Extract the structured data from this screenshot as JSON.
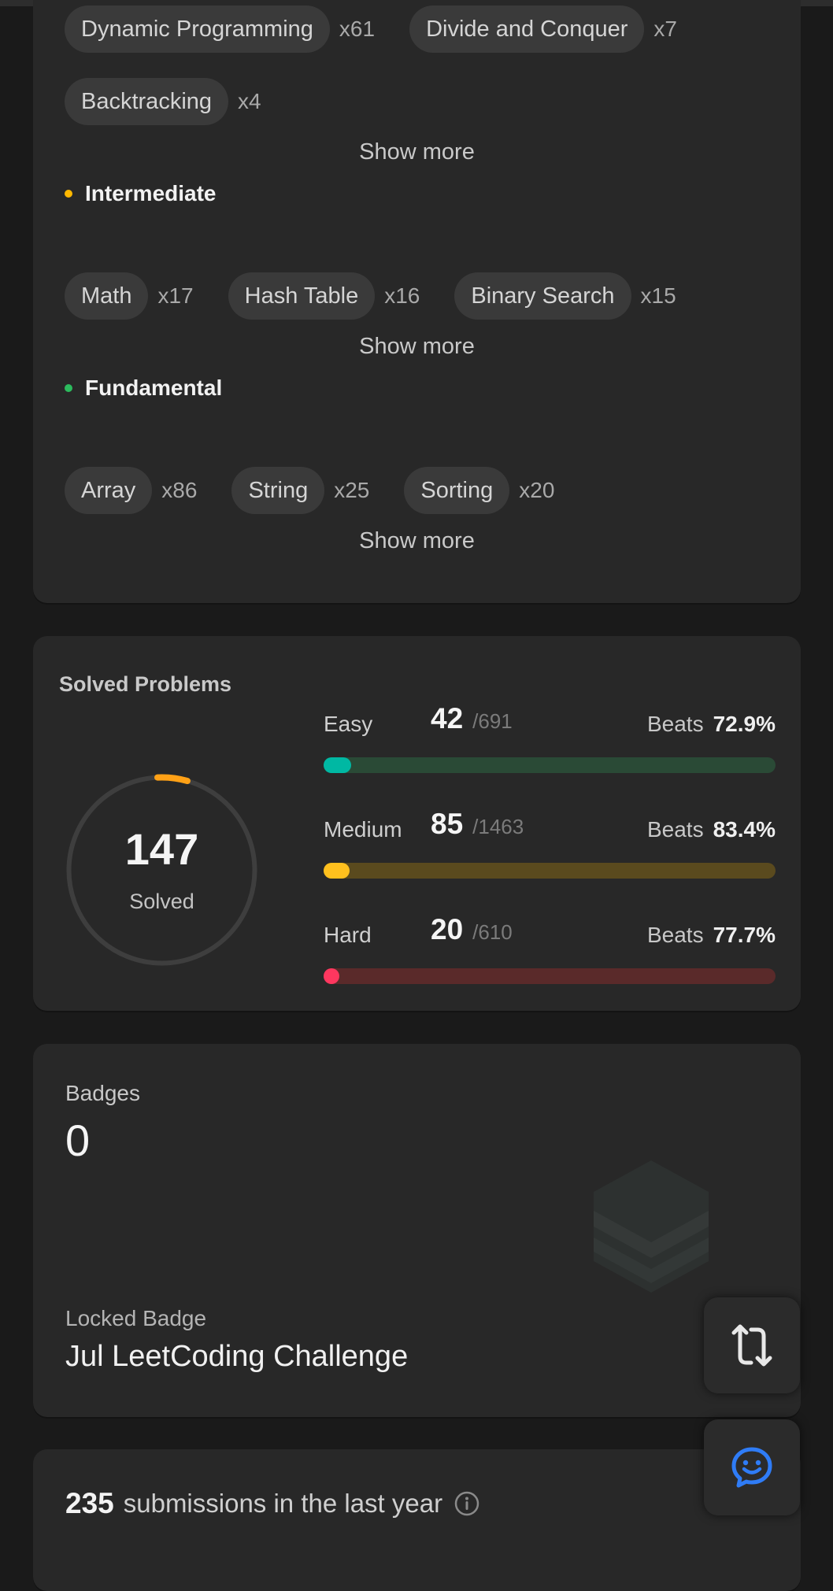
{
  "skills": {
    "advanced_tags": [
      {
        "name": "Dynamic Programming",
        "count": "x61"
      },
      {
        "name": "Divide and Conquer",
        "count": "x7"
      },
      {
        "name": "Backtracking",
        "count": "x4"
      }
    ],
    "intermediate": {
      "label": "Intermediate",
      "tags": [
        {
          "name": "Math",
          "count": "x17"
        },
        {
          "name": "Hash Table",
          "count": "x16"
        },
        {
          "name": "Binary Search",
          "count": "x15"
        }
      ]
    },
    "fundamental": {
      "label": "Fundamental",
      "tags": [
        {
          "name": "Array",
          "count": "x86"
        },
        {
          "name": "String",
          "count": "x25"
        },
        {
          "name": "Sorting",
          "count": "x20"
        }
      ]
    },
    "show_more_label": "Show more",
    "colors": {
      "intermediate_dot": "#ffb800",
      "fundamental_dot": "#2cbb5d"
    }
  },
  "solved": {
    "title": "Solved Problems",
    "total": "147",
    "total_label": "Solved",
    "beats_label": "Beats",
    "difficulties": [
      {
        "name": "Easy",
        "solved": "42",
        "total": "/691",
        "beats": "72.9%",
        "color": "#00b8a3",
        "track": "#2a4a36",
        "progress": 0.061
      },
      {
        "name": "Medium",
        "solved": "85",
        "total": "/1463",
        "beats": "83.4%",
        "color": "#ffc01e",
        "track": "#5a4a1e",
        "progress": 0.058
      },
      {
        "name": "Hard",
        "solved": "20",
        "total": "/610",
        "beats": "77.7%",
        "color": "#ff375f",
        "track": "#5a2a2a",
        "progress": 0.033
      }
    ],
    "ring": {
      "arc_color": "#ffa116",
      "track_color": "#3e3e3e"
    }
  },
  "badges": {
    "label": "Badges",
    "count": "0",
    "locked_label": "Locked Badge",
    "locked_name": "Jul LeetCoding Challenge"
  },
  "submissions": {
    "count": "235",
    "text": "submissions in the last year"
  },
  "icons": {
    "switch": "switch-layout-icon",
    "chat": "chat-smiley-icon",
    "info": "info-icon"
  },
  "accent_colors": {
    "chat_icon": "#2f7cf6"
  }
}
